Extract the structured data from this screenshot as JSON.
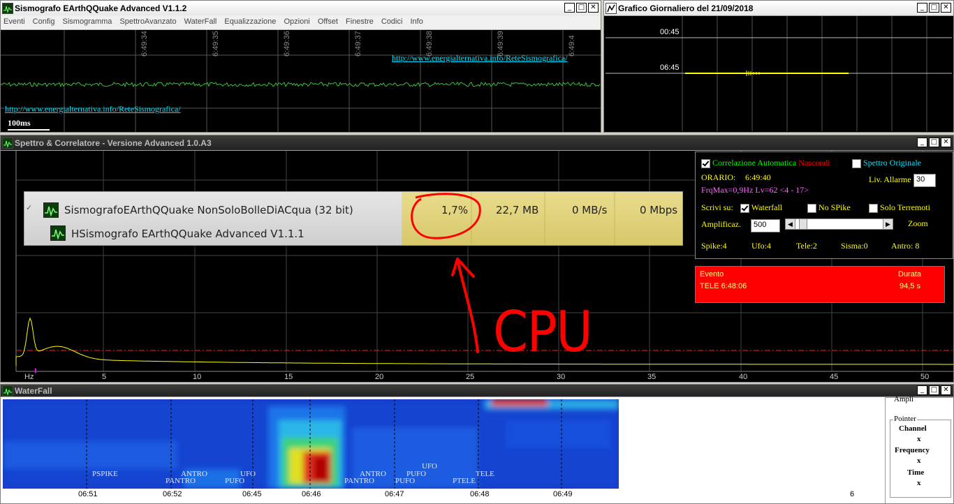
{
  "seismograph_window": {
    "title": "Sismografo  EArthQQuake Advanced V1.1.2",
    "menu": [
      "Eventi",
      "Config",
      "Sismogramma",
      "SpettroAvanzato",
      "WaterFall",
      "Equalizzazione",
      "Opzioni",
      "Offset",
      "Finestre",
      "Codici",
      "Info"
    ],
    "time_labels": [
      "6:49:34",
      "6:49:35",
      "6:49:36",
      "6:49:37",
      "6:49:38",
      "6:49:39",
      "6:49:4"
    ],
    "url_top": "http://www.energialternativa.info/ReteSismografica/",
    "url_bottom": "http://www.energialternativa.info/ReteSismografica/",
    "scale_label": "100ms"
  },
  "daily_window": {
    "title": "Grafico Giornaliero del 21/09/2018",
    "row_labels": [
      "00:45",
      "06:45"
    ]
  },
  "spectrum_window": {
    "title": "Spettro & Correlatore - Versione Advanced 1.0.A3",
    "x_axis_unit": "Hz",
    "x_ticks": [
      "5",
      "10",
      "15",
      "20",
      "25",
      "30",
      "35",
      "40",
      "45",
      "50"
    ],
    "annotation_text": "CPU",
    "colors": {
      "curve": "#ffff00",
      "threshold": "#ff2020",
      "annotation": "#ff0000"
    }
  },
  "task_manager_overlay": {
    "row1_name": "SismografoEArthQQuake  NonSoloBolleDiACqua (32 bit)",
    "row2_name": "HSismografo  EArthQQuake Advanced V1.1.1",
    "cpu": "1,7%",
    "memory": "22,7 MB",
    "disk": "0 MB/s",
    "network": "0 Mbps",
    "expand_glyph": "✓"
  },
  "control_panel": {
    "auto_correlation_label": "Correlazione Automatica",
    "auto_correlation_checked": true,
    "hide_label": "Nascondi",
    "original_spectrum_label": "Spettro Originale",
    "original_spectrum_checked": false,
    "orario_label": "ORARIO:",
    "orario_value": "6:49:40",
    "freq_info": "FrqMax=0,9Hz Lv=62 <4 - 17>",
    "alarm_label": "Liv. Allarme",
    "alarm_value": "30",
    "write_on_label": "Scrivi su:",
    "waterfall_label": "Waterfall",
    "waterfall_checked": true,
    "no_spike_label": "No SPike",
    "no_spike_checked": false,
    "only_quakes_label": "Solo Terremoti",
    "only_quakes_checked": false,
    "amplification_label": "Amplificaz.",
    "amplification_value": "500",
    "zoom_label": "Zoom",
    "zoom_level": 0.04,
    "counters": {
      "spike": "Spike:4",
      "ufo": "Ufo:4",
      "tele": "Tele:2",
      "sisma": "Sisma:0",
      "antro": "Antro: 8"
    }
  },
  "event_box": {
    "event_header": "Evento",
    "duration_header": "Durata",
    "event_value": "TELE 6:48:06",
    "duration_value": "94,5 s"
  },
  "waterfall_window": {
    "title": "WaterFall",
    "event_labels": [
      "PSPIKE",
      "ANTRO",
      "PANTRO",
      "UFO",
      "PUFO",
      "ANTRO",
      "PANTRO",
      "PUFO",
      "UFO",
      "PUFO",
      "PTELE",
      "TELE"
    ],
    "time_ticks": [
      "06:51",
      "06:52",
      "06:45",
      "06:46",
      "06:47",
      "06:48",
      "06:49"
    ],
    "side_number": "6",
    "info_partial": "Ampli",
    "pointer_group": "Pointer",
    "channel_label": "Channel",
    "channel_value": "x",
    "frequency_label": "Frequency",
    "frequency_value": "x",
    "time_label": "Time",
    "time_value": "x"
  }
}
